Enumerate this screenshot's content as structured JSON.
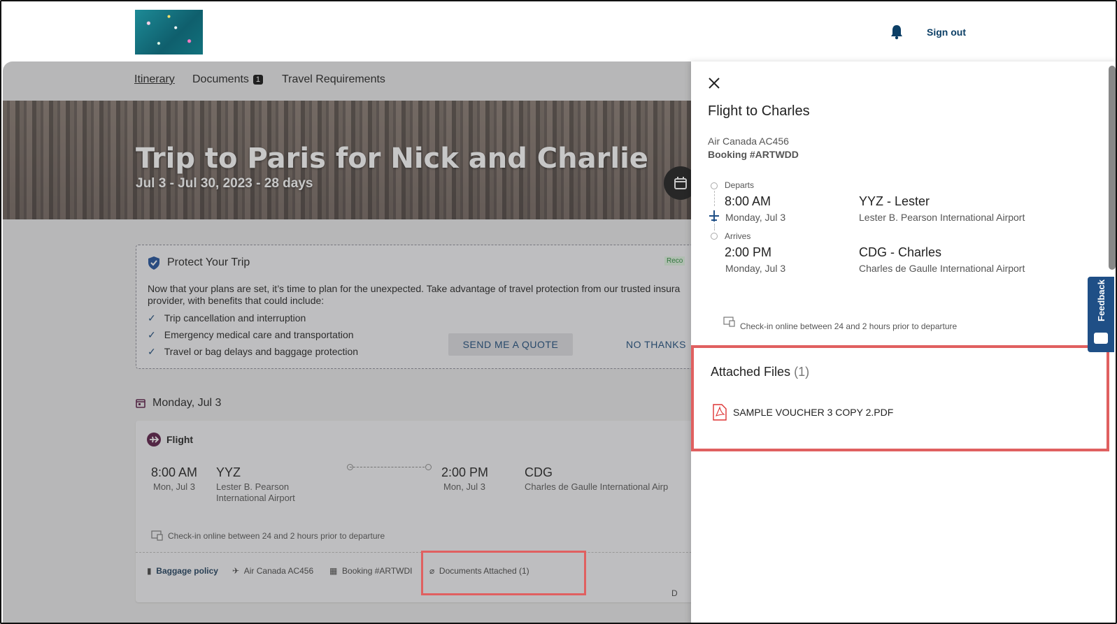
{
  "header": {
    "sign_out": "Sign out"
  },
  "tabs": {
    "itinerary": "Itinerary",
    "documents": "Documents",
    "documents_count": "1",
    "travel_requirements": "Travel Requirements"
  },
  "hero": {
    "title": "Trip to Paris for Nick and Charlie",
    "subtitle": "Jul 3 - Jul 30, 2023 - 28 days"
  },
  "protect": {
    "title": "Protect Your Trip",
    "badge": "Reco",
    "description": "Now that your plans are set, it’s time to plan for the unexpected. Take advantage of travel protection from our trusted insura provider, with benefits that could include:",
    "benefits": [
      "Trip cancellation and interruption",
      "Emergency medical care and transportation",
      "Travel or bag delays and baggage protection"
    ],
    "quote_button": "SEND ME A QUOTE",
    "no_thanks": "NO THANKS"
  },
  "itinerary": {
    "day_label": "Monday, Jul 3",
    "flight": {
      "label": "Flight",
      "depart_time": "8:00 AM",
      "depart_date": "Mon, Jul 3",
      "depart_code": "YYZ",
      "depart_airport_1": "Lester B. Pearson",
      "depart_airport_2": "International Airport",
      "arrive_time": "2:00 PM",
      "arrive_date": "Mon, Jul 3",
      "arrive_code": "CDG",
      "arrive_airport": "Charles de Gaulle International Airp",
      "checkin": "Check-in online between 24 and 2 hours prior to departure",
      "baggage": "Baggage policy",
      "airline": "Air Canada AC456",
      "booking": "Booking #ARTWDI",
      "documents": "Documents Attached (1)",
      "more": "D"
    }
  },
  "panel": {
    "title": "Flight to Charles",
    "airline": "Air Canada AC456",
    "booking": "Booking #ARTWDD",
    "departs_label": "Departs",
    "depart_time": "8:00 AM",
    "depart_date": "Monday, Jul 3",
    "depart_code": "YYZ - Lester",
    "depart_airport": "Lester B. Pearson International Airport",
    "arrives_label": "Arrives",
    "arrive_time": "2:00 PM",
    "arrive_date": "Monday, Jul 3",
    "arrive_code": "CDG - Charles",
    "arrive_airport": "Charles de Gaulle International Airport",
    "checkin": "Check-in online between 24 and 2 hours prior to departure",
    "attached_title": "Attached Files",
    "attached_count": "(1)",
    "file_name": "SAMPLE VOUCHER 3 COPY 2.PDF"
  },
  "feedback": "Feedback",
  "colors": {
    "accent": "#0c3f66",
    "highlight": "#e06060",
    "flight_icon": "#5a1a45"
  }
}
